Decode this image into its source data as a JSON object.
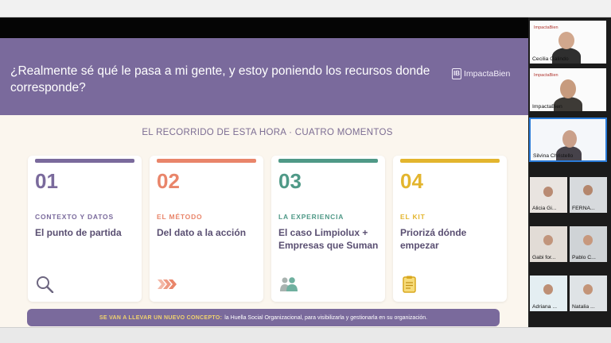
{
  "slide": {
    "title": "¿Realmente sé qué le pasa a mi gente, y estoy poniendo los recursos donde corresponde?",
    "brand": {
      "mark": "IB",
      "name": "ImpactaBien"
    },
    "section_heading": "EL RECORRIDO DE ESTA HORA · CUATRO MOMENTOS",
    "cards": [
      {
        "number": "01",
        "category": "CONTEXTO Y DATOS",
        "title": "El punto de partida",
        "color": "#7a6a9c",
        "icon": "magnifier-icon"
      },
      {
        "number": "02",
        "category": "EL MÉTODO",
        "title": "Del dato a la acción",
        "color": "#e9856a",
        "icon": "chevrons-right-icon"
      },
      {
        "number": "03",
        "category": "LA EXPERIENCIA",
        "title": "El caso Limpiolux + Empresas que Suman",
        "color": "#4f9987",
        "icon": "people-icon"
      },
      {
        "number": "04",
        "category": "EL KIT",
        "title": "Priorizá dónde empezar",
        "color": "#e3b52e",
        "icon": "clipboard-icon"
      }
    ],
    "banner": {
      "strong": "SE VAN A LLEVAR UN NUEVO CONCEPTO:",
      "text": "la Huella Social Organizacional, para visibilizarla y gestionarla en su organización."
    }
  },
  "participants": [
    {
      "name": "Cecilia Galindo",
      "logo": "ImpactaBien"
    },
    {
      "name": "ImpactaBien",
      "logo": "ImpactaBien"
    },
    {
      "name": "Silvina Christello",
      "logo": ""
    },
    {
      "name": "Alicia Gi...",
      "logo": ""
    },
    {
      "name": "FERNA...",
      "logo": ""
    },
    {
      "name": "Gabi for...",
      "logo": ""
    },
    {
      "name": "Pablo C...",
      "logo": ""
    },
    {
      "name": "Adriana ...",
      "logo": ""
    },
    {
      "name": "Natalia ...",
      "logo": ""
    }
  ]
}
